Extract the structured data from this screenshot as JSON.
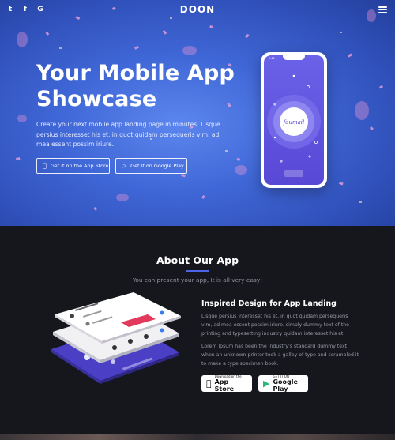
{
  "header": {
    "logo": "DOON",
    "social": [
      {
        "icon": "twitter-icon",
        "glyph": "t"
      },
      {
        "icon": "facebook-icon",
        "glyph": "f"
      },
      {
        "icon": "google-icon",
        "glyph": "G"
      }
    ],
    "menu_icon": "hamburger-menu-icon"
  },
  "hero": {
    "title_line1": "Your Mobile App",
    "title_line2": "Showcase",
    "description": "Create your next mobile app landing page in minutes. Lisque persius interesset his et, in quot quidam persequeris vim, ad mea essent possim iriure.",
    "app_store_button": "Get it on the App Store",
    "google_play_button": "Get it on Google Play",
    "phone_app_name": "faumail",
    "phone_time": "9:41"
  },
  "about": {
    "title": "About Our App",
    "subtitle": "You can present your app, It is all very easy!",
    "feature_title": "Inspired Design for App Landing",
    "paragraph1": "Lisque persius interesset his et, in quot quidam persequeris vim, ad mea essent possim iriure. simply dummy text of the printing and typesetting industry quidam interesset his et.",
    "paragraph2": "Lorem Ipsum has been the industry's standard dummy text when an unknown printer took a galley of type and scrambled it to make a type specimen book.",
    "app_store_small": "Download on the",
    "app_store_big": "App Store",
    "google_play_small": "GET IT ON",
    "google_play_big": "Google Play"
  },
  "colors": {
    "hero_blue": "#3f66d6",
    "accent": "#4d63e8",
    "dark_bg": "#16171c",
    "phone_purple": "#5f57e2"
  }
}
